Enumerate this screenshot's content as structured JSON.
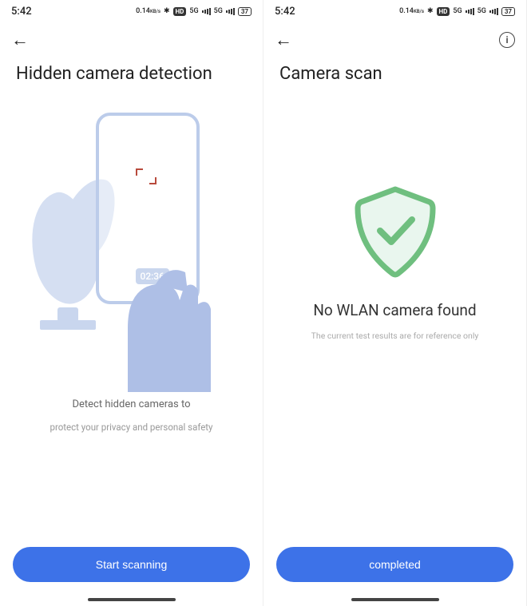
{
  "status": {
    "time": "5:42",
    "kbps": "0.14",
    "kbps_unit": "KB/s",
    "hd": "HD",
    "net": "5G",
    "battery": "37"
  },
  "screen1": {
    "title": "Hidden camera detection",
    "clock_badge": "02:36",
    "desc_line1": "Detect hidden cameras to",
    "desc_line2": "protect your privacy and personal safety",
    "button": "Start scanning"
  },
  "screen2": {
    "title": "Camera scan",
    "result_title": "No WLAN camera found",
    "result_sub": "The current test results are for reference only",
    "button": "completed"
  }
}
